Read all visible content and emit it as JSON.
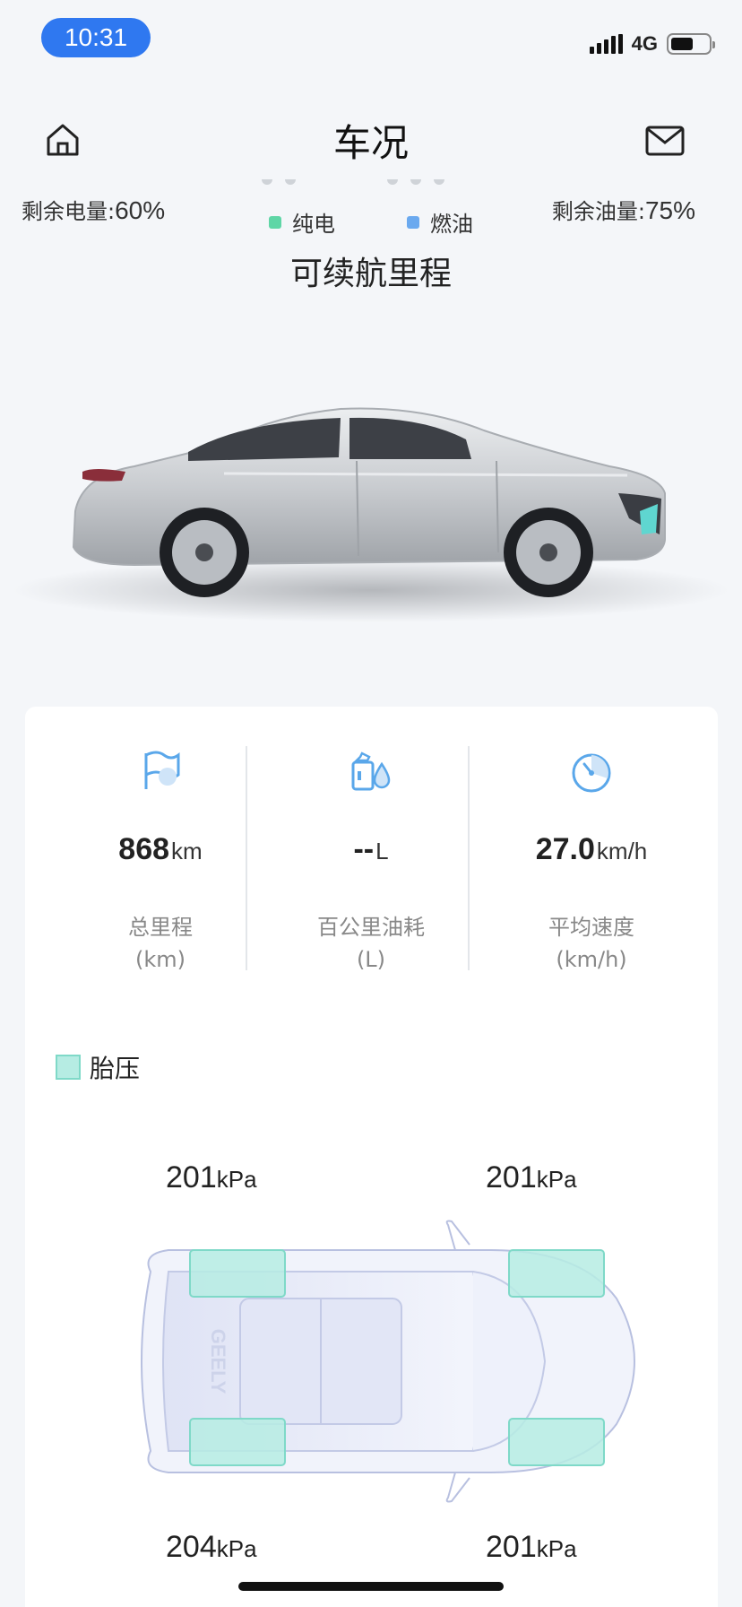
{
  "status_bar": {
    "time": "10:31",
    "network": "4G",
    "battery_level": 0.6
  },
  "nav": {
    "title": "车况"
  },
  "range": {
    "battery_label": "剩余电量:",
    "battery_value": "60%",
    "fuel_label": "剩余油量:",
    "fuel_value": "75%",
    "legend_ev": "纯电",
    "legend_fuel": "燃油",
    "title": "可续航里程"
  },
  "stats": [
    {
      "icon": "flag-icon",
      "value": "868",
      "unit": "km",
      "label": "总里程",
      "sub": "(km)"
    },
    {
      "icon": "fuel-drop-icon",
      "value": "--",
      "unit": "L",
      "label": "百公里油耗",
      "sub": "(L)"
    },
    {
      "icon": "speedometer-icon",
      "value": "27.0",
      "unit": "km/h",
      "label": "平均速度",
      "sub": "(km/h)"
    }
  ],
  "tire": {
    "legend": "胎压",
    "front_left": "201",
    "front_right": "201",
    "rear_left": "204",
    "rear_right": "201",
    "unit": "kPa",
    "brand": "GEELY"
  },
  "colors": {
    "accent": "#2f78f0",
    "tire_fill": "#b6ece3",
    "icon_blue": "#5aa7ea"
  }
}
